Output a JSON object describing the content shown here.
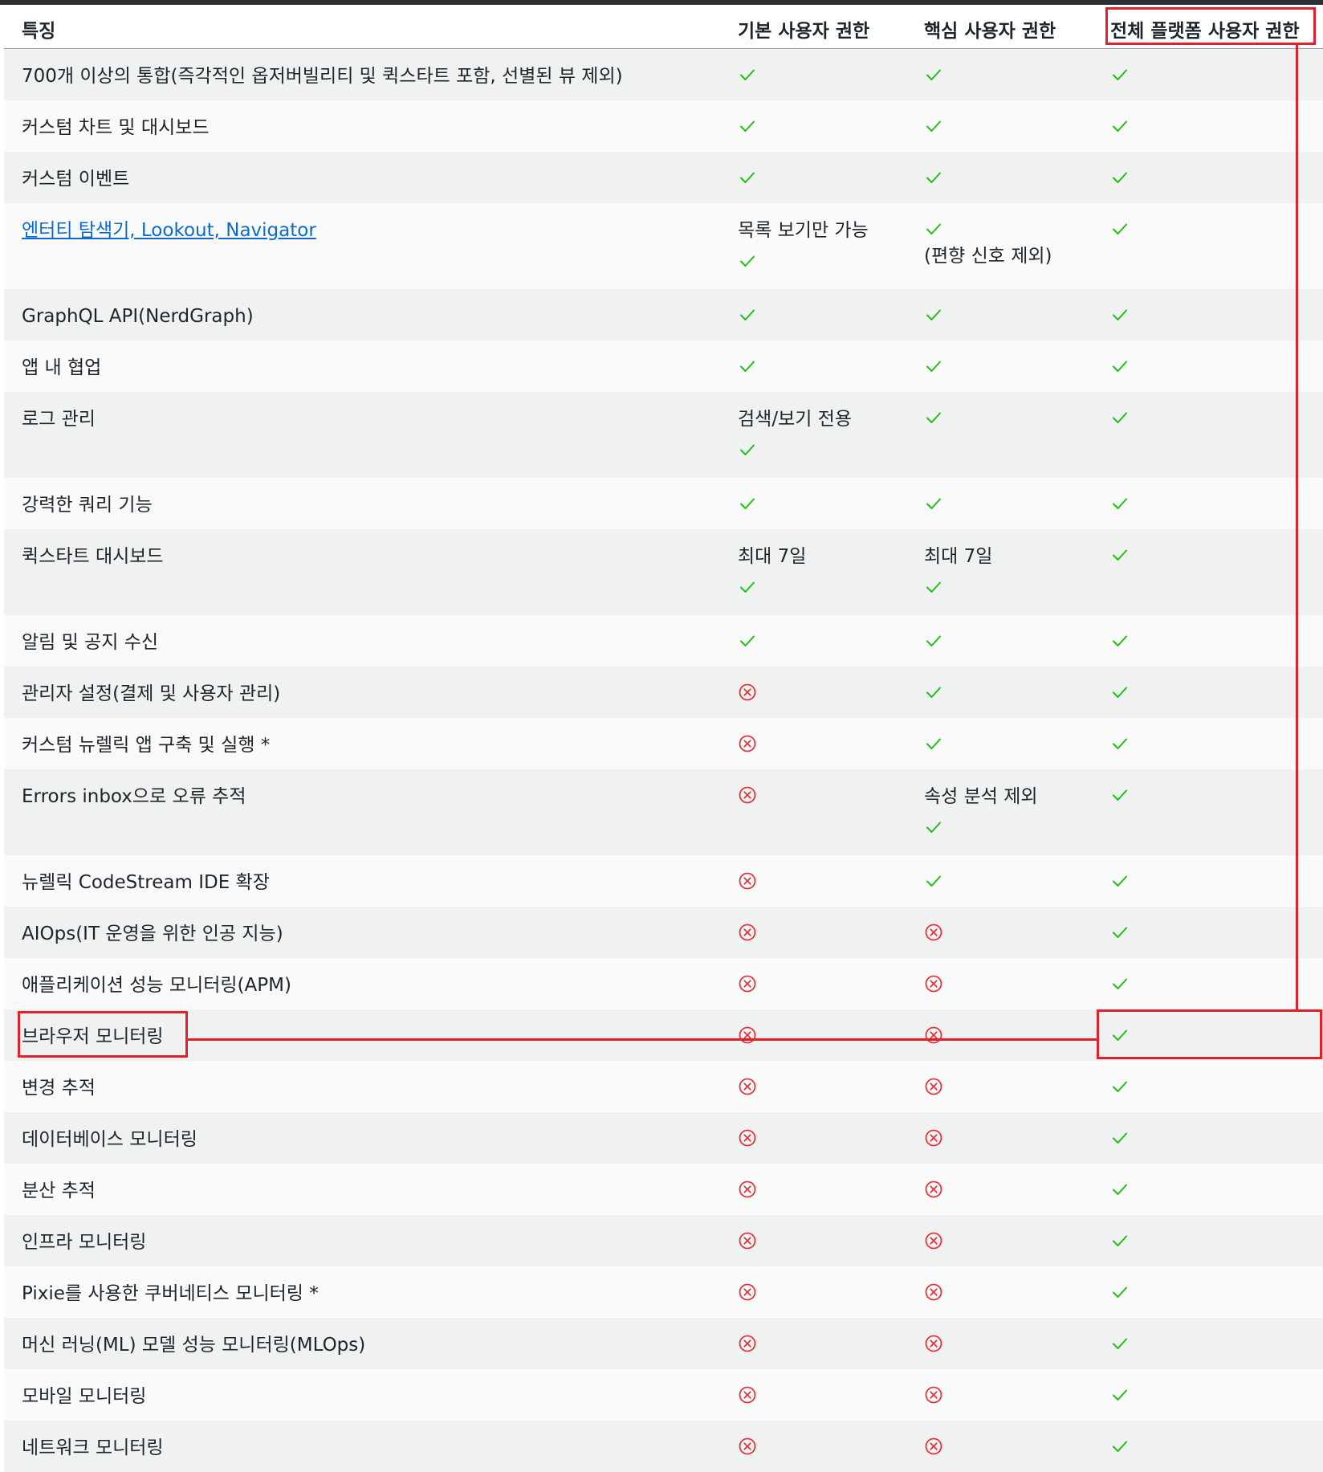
{
  "header": {
    "feature": "특징",
    "basic": "기본 사용자 권한",
    "core": "핵심 사용자 권한",
    "full": "전체 플랫폼 사용자 권한"
  },
  "colors": {
    "check": "#22c016",
    "cross": "#e3343a",
    "highlight": "#e0202a",
    "link": "#0b6acb"
  },
  "rows": [
    {
      "feature": "700개 이상의 통합(즉각적인 옵저버빌리티 및 퀵스타트 포함, 선별된 뷰 제외)",
      "basic": {
        "icon": "check"
      },
      "core": {
        "icon": "check"
      },
      "full": {
        "icon": "check"
      }
    },
    {
      "feature": "커스텀 차트 및 대시보드",
      "basic": {
        "icon": "check"
      },
      "core": {
        "icon": "check"
      },
      "full": {
        "icon": "check"
      }
    },
    {
      "feature": "커스텀 이벤트",
      "basic": {
        "icon": "check"
      },
      "core": {
        "icon": "check"
      },
      "full": {
        "icon": "check"
      }
    },
    {
      "feature": "엔터티 탐색기, Lookout, Navigator",
      "link": true,
      "basic": {
        "text": "목록 보기만 가능",
        "icon": "check",
        "order": "text-first"
      },
      "core": {
        "text": "(편향 신호 제외)",
        "icon": "check",
        "order": "icon-first"
      },
      "full": {
        "icon": "check"
      }
    },
    {
      "feature": "GraphQL API(NerdGraph)",
      "basic": {
        "icon": "check"
      },
      "core": {
        "icon": "check"
      },
      "full": {
        "icon": "check"
      }
    },
    {
      "feature": "앱 내 협업",
      "basic": {
        "icon": "check"
      },
      "core": {
        "icon": "check"
      },
      "full": {
        "icon": "check"
      }
    },
    {
      "feature": "로그 관리",
      "basic": {
        "text": "검색/보기 전용",
        "icon": "check",
        "order": "text-first"
      },
      "core": {
        "icon": "check"
      },
      "full": {
        "icon": "check"
      }
    },
    {
      "feature": "강력한 쿼리 기능",
      "basic": {
        "icon": "check"
      },
      "core": {
        "icon": "check"
      },
      "full": {
        "icon": "check"
      }
    },
    {
      "feature": "퀵스타트 대시보드",
      "basic": {
        "text": "최대 7일",
        "icon": "check",
        "order": "text-first"
      },
      "core": {
        "text": "최대 7일",
        "icon": "check",
        "order": "text-first"
      },
      "full": {
        "icon": "check"
      }
    },
    {
      "feature": "알림 및 공지 수신",
      "basic": {
        "icon": "check"
      },
      "core": {
        "icon": "check"
      },
      "full": {
        "icon": "check"
      }
    },
    {
      "feature": "관리자 설정(결제 및 사용자 관리)",
      "basic": {
        "icon": "cross"
      },
      "core": {
        "icon": "check"
      },
      "full": {
        "icon": "check"
      }
    },
    {
      "feature": "커스텀 뉴렐릭 앱 구축 및 실행 *",
      "basic": {
        "icon": "cross"
      },
      "core": {
        "icon": "check"
      },
      "full": {
        "icon": "check"
      }
    },
    {
      "feature": "Errors inbox으로 오류 추적",
      "basic": {
        "icon": "cross"
      },
      "core": {
        "text": "속성 분석 제외",
        "icon": "check",
        "order": "text-first"
      },
      "full": {
        "icon": "check"
      }
    },
    {
      "feature": "뉴렐릭 CodeStream IDE 확장",
      "basic": {
        "icon": "cross"
      },
      "core": {
        "icon": "check"
      },
      "full": {
        "icon": "check"
      }
    },
    {
      "feature": "AIOps(IT 운영을 위한 인공 지능)",
      "basic": {
        "icon": "cross"
      },
      "core": {
        "icon": "cross"
      },
      "full": {
        "icon": "check"
      }
    },
    {
      "feature": "애플리케이션 성능 모니터링(APM)",
      "basic": {
        "icon": "cross"
      },
      "core": {
        "icon": "cross"
      },
      "full": {
        "icon": "check"
      }
    },
    {
      "feature": "브라우저 모니터링",
      "basic": {
        "icon": "cross"
      },
      "core": {
        "icon": "cross"
      },
      "full": {
        "icon": "check"
      }
    },
    {
      "feature": "변경 추적",
      "basic": {
        "icon": "cross"
      },
      "core": {
        "icon": "cross"
      },
      "full": {
        "icon": "check"
      }
    },
    {
      "feature": "데이터베이스 모니터링",
      "basic": {
        "icon": "cross"
      },
      "core": {
        "icon": "cross"
      },
      "full": {
        "icon": "check"
      }
    },
    {
      "feature": "분산 추적",
      "basic": {
        "icon": "cross"
      },
      "core": {
        "icon": "cross"
      },
      "full": {
        "icon": "check"
      }
    },
    {
      "feature": "인프라 모니터링",
      "basic": {
        "icon": "cross"
      },
      "core": {
        "icon": "cross"
      },
      "full": {
        "icon": "check"
      }
    },
    {
      "feature": "Pixie를 사용한 쿠버네티스 모니터링 *",
      "basic": {
        "icon": "cross"
      },
      "core": {
        "icon": "cross"
      },
      "full": {
        "icon": "check"
      }
    },
    {
      "feature": "머신 러닝(ML) 모델 성능 모니터링(MLOps)",
      "basic": {
        "icon": "cross"
      },
      "core": {
        "icon": "cross"
      },
      "full": {
        "icon": "check"
      }
    },
    {
      "feature": "모바일 모니터링",
      "basic": {
        "icon": "cross"
      },
      "core": {
        "icon": "cross"
      },
      "full": {
        "icon": "check"
      }
    },
    {
      "feature": "네트워크 모니터링",
      "basic": {
        "icon": "cross"
      },
      "core": {
        "icon": "cross"
      },
      "full": {
        "icon": "check"
      }
    }
  ]
}
